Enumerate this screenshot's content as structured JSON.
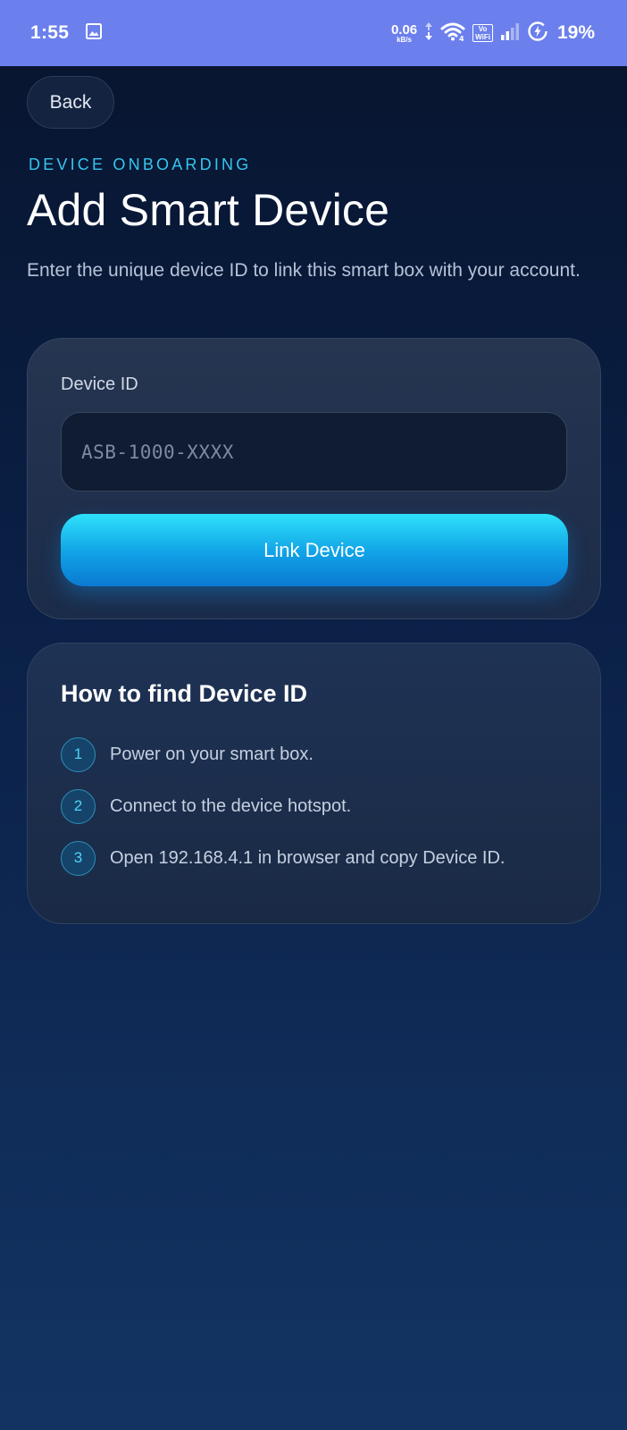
{
  "status_bar": {
    "time": "1:55",
    "net_speed_value": "0.06",
    "net_speed_unit": "kB/s",
    "wifi_badge_top": "Vo",
    "wifi_badge_bottom": "WiFi",
    "battery_percent": "19%",
    "icons": [
      "gallery-icon",
      "data-arrows-icon",
      "wifi-icon",
      "vowifi-icon",
      "signal-bars-icon",
      "battery-saver-icon"
    ]
  },
  "nav": {
    "back_label": "Back"
  },
  "header": {
    "eyebrow": "DEVICE ONBOARDING",
    "title": "Add Smart Device",
    "subtitle": "Enter the unique device ID to link this smart box with your account."
  },
  "form": {
    "device_id_label": "Device ID",
    "device_id_value": "",
    "device_id_placeholder": "ASB-1000-XXXX",
    "submit_label": "Link Device"
  },
  "help": {
    "title": "How to find Device ID",
    "steps": [
      {
        "number": "1",
        "text": "Power on your smart box."
      },
      {
        "number": "2",
        "text": "Connect to the device hotspot."
      },
      {
        "number": "3",
        "text": "Open 192.168.4.1 in browser and copy Device ID."
      }
    ]
  },
  "colors": {
    "status_bar": "#6b80ec",
    "accent_cyan": "#35c6ee",
    "background_top": "#07142e",
    "background_bottom": "#133463",
    "button_gradient_top": "#2ee1fb",
    "button_gradient_bottom": "#0b7ad2"
  }
}
